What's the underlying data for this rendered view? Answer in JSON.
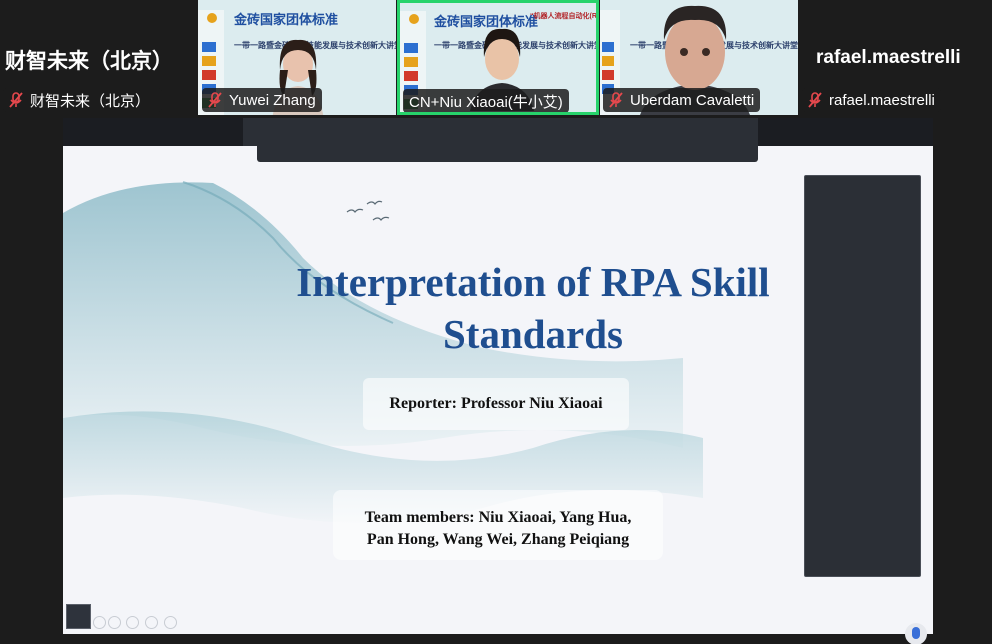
{
  "participants": [
    {
      "display_name": "财智未来（北京）",
      "name_label": "财智未来（北京）",
      "muted": true,
      "video": false
    },
    {
      "name_label": "Yuwei Zhang",
      "muted": true,
      "video": true
    },
    {
      "name_label": "CN+Niu Xiaoai(牛小艾)",
      "muted": false,
      "video": true,
      "active_speaker": true
    },
    {
      "name_label": "Uberdam Cavaletti",
      "muted": true,
      "video": true
    },
    {
      "display_name": "rafael.maestrelli",
      "name_label": "rafael.maestrelli",
      "muted": true,
      "video": false
    }
  ],
  "video_background": {
    "title": "金砖国家团体标准",
    "title_tag": "“机器人流程自动化(RPA)”",
    "subtitle": "一带一路暨金砖国家技能发展与技术创新大讲堂"
  },
  "slide": {
    "title": "Interpretation of RPA Skill Standards",
    "reporter": "Reporter: Professor Niu Xiaoai",
    "team_line1": "Team members: Niu Xiaoai, Yang Hua,",
    "team_line2": "Pan Hong, Wang Wei, Zhang Peiqiang"
  },
  "colors": {
    "active_speaker_border": "#27d36b",
    "muted_icon": "#e5484d",
    "slide_title": "#1f4e8f",
    "app_background": "#1c1c1c"
  },
  "icons": [
    "mic-muted-icon",
    "mic-icon",
    "birds-icon",
    "scroll-mouse-icon"
  ]
}
